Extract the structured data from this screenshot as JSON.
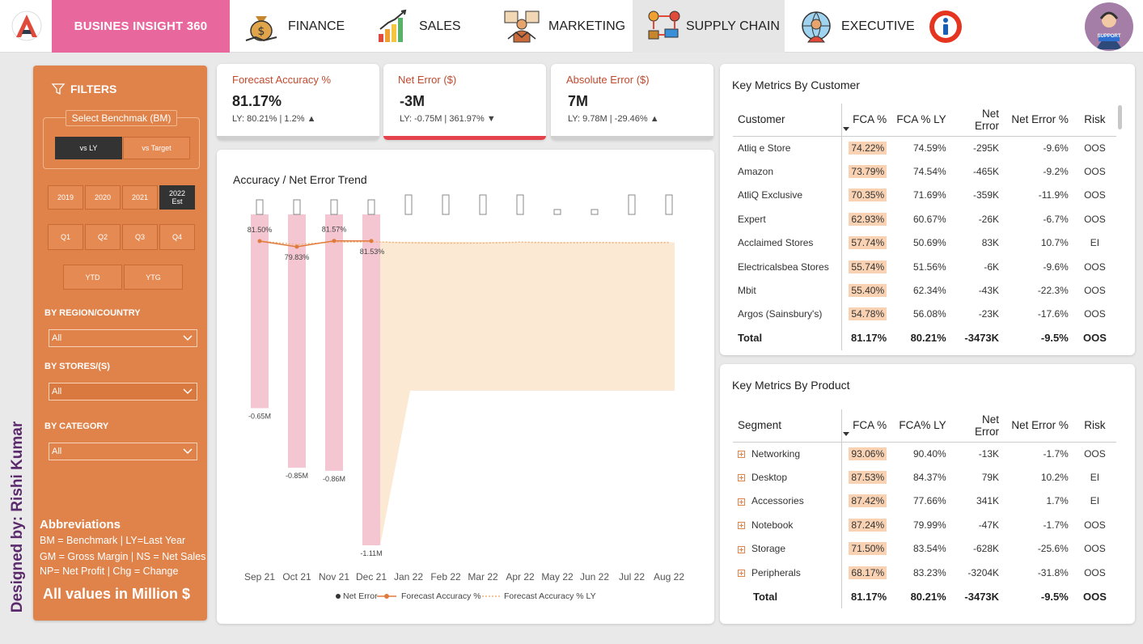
{
  "nav": {
    "brand": "BUSINES INSIGHT 360",
    "items": [
      {
        "label": "FINANCE",
        "icon": "money-bag-icon"
      },
      {
        "label": "SALES",
        "icon": "growth-chart-icon"
      },
      {
        "label": "MARKETING",
        "icon": "marketing-icon"
      },
      {
        "label": "SUPPLY CHAIN",
        "icon": "supply-chain-icon",
        "active": true
      },
      {
        "label": "EXECUTIVE",
        "icon": "executive-globe-icon"
      }
    ],
    "support_label": "SUPPORT"
  },
  "filters": {
    "title": "FILTERS",
    "benchmark_label": "Select Benchmak (BM)",
    "benchmark_options": [
      "vs LY",
      "vs Target"
    ],
    "benchmark_selected": "vs LY",
    "years": [
      "2019",
      "2020",
      "2021",
      "2022\nEst"
    ],
    "year_selected": "2022\nEst",
    "quarters": [
      "Q1",
      "Q2",
      "Q3",
      "Q4"
    ],
    "period": [
      "YTD",
      "YTG"
    ],
    "region": {
      "label": "BY REGION/COUNTRY",
      "value": "All"
    },
    "stores": {
      "label": "BY STORES/(S)",
      "value": "All"
    },
    "category": {
      "label": "BY CATEGORY",
      "value": "All"
    },
    "abbreviations": {
      "title": "Abbreviations",
      "lines": [
        "BM = Benchmark | LY=Last Year",
        "GM = Gross Margin | NS = Net Sales",
        "NP= Net Profit | Chg = Change"
      ]
    },
    "all_values": "All values in Million $",
    "designed_by": "Designed by: Rishi Kumar"
  },
  "kpis": [
    {
      "label": "Forecast Accuracy %",
      "value": "81.17%",
      "sub": "LY: 80.21% | 1.2%",
      "trend": "up",
      "bar": "grey"
    },
    {
      "label": "Net Error ($)",
      "value": "-3M",
      "sub": "LY: -0.75M | 361.97%",
      "trend": "down",
      "bar": "red"
    },
    {
      "label": "Absolute Error ($)",
      "value": "7M",
      "sub": "LY: 9.78M | -29.46%",
      "trend": "up",
      "bar": "grey"
    }
  ],
  "chart_data": {
    "type": "bar",
    "title": "Accuracy / Net Error Trend",
    "categories": [
      "Sep 21",
      "Oct 21",
      "Nov 21",
      "Dec 21",
      "Jan 22",
      "Feb 22",
      "Mar 22",
      "Apr 22",
      "May 22",
      "Jun 22",
      "Jul 22",
      "Aug 22"
    ],
    "series": [
      {
        "name": "Net Error",
        "kind": "bar",
        "unit": "M",
        "values": [
          -0.65,
          -0.85,
          -0.86,
          -1.11,
          null,
          null,
          null,
          null,
          null,
          null,
          null,
          null
        ]
      },
      {
        "name": "Forecast Accuracy %",
        "kind": "line",
        "values": [
          81.5,
          79.83,
          81.57,
          81.53,
          null,
          null,
          null,
          null,
          null,
          null,
          null,
          null
        ]
      },
      {
        "name": "Forecast Accuracy % LY",
        "kind": "dotted-line",
        "values": [
          81.5,
          80.5,
          81.2,
          81.3,
          81.0,
          80.9,
          80.9,
          81.2,
          81.0,
          81.1,
          81.0,
          81.1
        ]
      }
    ],
    "data_labels": {
      "net_error": [
        "-0.65M",
        "-0.85M",
        "-0.86M",
        "-1.11M"
      ],
      "accuracy": [
        "81.50%",
        "79.83%",
        "81.57%",
        "81.53%"
      ]
    },
    "legend": "bottom",
    "colors": {
      "net_error": "#f4c6d2",
      "accuracy": "#e07a3b",
      "accuracy_ly": "#f0b27a",
      "forecast_area": "#fbe9d3"
    }
  },
  "customer_table": {
    "title": "Key Metrics By Customer",
    "columns": [
      "Customer",
      "FCA %",
      "FCA % LY",
      "Net Error",
      "Net Error %",
      "Risk"
    ],
    "rows": [
      [
        "Atliq e Store",
        "74.22%",
        "74.59%",
        "-295K",
        "-9.6%",
        "OOS"
      ],
      [
        "Amazon",
        "73.79%",
        "74.54%",
        "-465K",
        "-9.2%",
        "OOS"
      ],
      [
        "AtliQ Exclusive",
        "70.35%",
        "71.69%",
        "-359K",
        "-11.9%",
        "OOS"
      ],
      [
        "Expert",
        "62.93%",
        "60.67%",
        "-26K",
        "-6.7%",
        "OOS"
      ],
      [
        "Acclaimed Stores",
        "57.74%",
        "50.69%",
        "83K",
        "10.7%",
        "EI"
      ],
      [
        "Electricalsbea Stores",
        "55.74%",
        "51.56%",
        "-6K",
        "-9.6%",
        "OOS"
      ],
      [
        "Mbit",
        "55.40%",
        "62.34%",
        "-43K",
        "-22.3%",
        "OOS"
      ],
      [
        "Argos (Sainsbury's)",
        "54.78%",
        "56.08%",
        "-23K",
        "-17.6%",
        "OOS"
      ]
    ],
    "total": [
      "Total",
      "81.17%",
      "80.21%",
      "-3473K",
      "-9.5%",
      "OOS"
    ]
  },
  "product_table": {
    "title": "Key Metrics By Product",
    "columns": [
      "Segment",
      "FCA %",
      "FCA% LY",
      "Net Error",
      "Net Error %",
      "Risk"
    ],
    "rows": [
      [
        "Networking",
        "93.06%",
        "90.40%",
        "-13K",
        "-1.7%",
        "OOS"
      ],
      [
        "Desktop",
        "87.53%",
        "84.37%",
        "79K",
        "10.2%",
        "EI"
      ],
      [
        "Accessories",
        "87.42%",
        "77.66%",
        "341K",
        "1.7%",
        "EI"
      ],
      [
        "Notebook",
        "87.24%",
        "79.99%",
        "-47K",
        "-1.7%",
        "OOS"
      ],
      [
        "Storage",
        "71.50%",
        "83.54%",
        "-628K",
        "-25.6%",
        "OOS"
      ],
      [
        "Peripherals",
        "68.17%",
        "83.23%",
        "-3204K",
        "-31.8%",
        "OOS"
      ]
    ],
    "total": [
      "Total",
      "81.17%",
      "80.21%",
      "-3473K",
      "-9.5%",
      "OOS"
    ]
  }
}
